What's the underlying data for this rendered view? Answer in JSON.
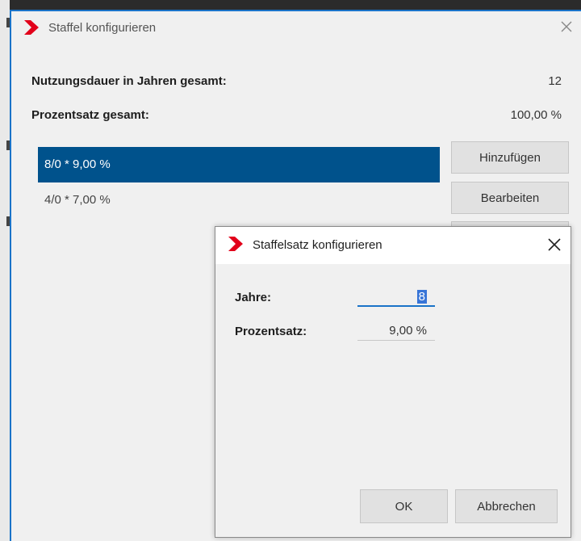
{
  "main_dialog": {
    "title": "Staffel konfigurieren",
    "rows": [
      {
        "label": "Nutzungsdauer in Jahren gesamt:",
        "value": "12"
      },
      {
        "label": "Prozentsatz gesamt:",
        "value": "100,00 %"
      }
    ],
    "list_items": [
      {
        "text": "8/0 * 9,00 %",
        "selected": true
      },
      {
        "text": "4/0 * 7,00 %",
        "selected": false
      }
    ],
    "buttons": {
      "add": "Hinzufügen",
      "edit": "Bearbeiten"
    }
  },
  "sub_dialog": {
    "title": "Staffelsatz konfigurieren",
    "fields": {
      "years": {
        "label": "Jahre:",
        "value": "8"
      },
      "percent": {
        "label": "Prozentsatz:",
        "value": "9,00 %"
      }
    },
    "buttons": {
      "ok": "OK",
      "cancel": "Abbrechen"
    }
  },
  "colors": {
    "accent": "#00528c",
    "logo_red": "#e2001a",
    "border_blue": "#1a73c8"
  },
  "icons": {
    "logo": "red-chevron-logo-icon",
    "close": "close-icon"
  }
}
